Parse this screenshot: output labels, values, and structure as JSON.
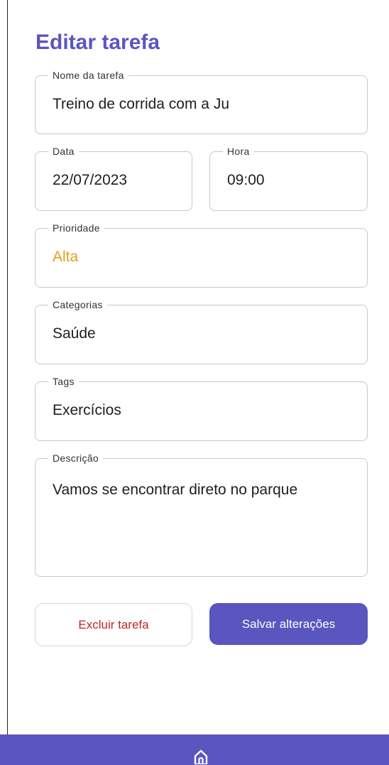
{
  "header": {
    "title": "Editar tarefa"
  },
  "form": {
    "name": {
      "label": "Nome da tarefa",
      "value": "Treino de corrida com a Ju"
    },
    "date": {
      "label": "Data",
      "value": "22/07/2023"
    },
    "time": {
      "label": "Hora",
      "value": "09:00"
    },
    "priority": {
      "label": "Prioridade",
      "value": "Alta"
    },
    "category": {
      "label": "Categorias",
      "value": "Saúde"
    },
    "tags": {
      "label": "Tags",
      "value": "Exercícios"
    },
    "description": {
      "label": "Descrição",
      "value": "Vamos se encontrar direto no parque"
    }
  },
  "actions": {
    "delete_label": "Excluir tarefa",
    "save_label": "Salvar alterações"
  },
  "bottom_nav": {
    "icon": "home-icon"
  },
  "colors": {
    "primary": "#5b55c0",
    "priority_high": "#e0a21d",
    "danger": "#c0251f"
  }
}
